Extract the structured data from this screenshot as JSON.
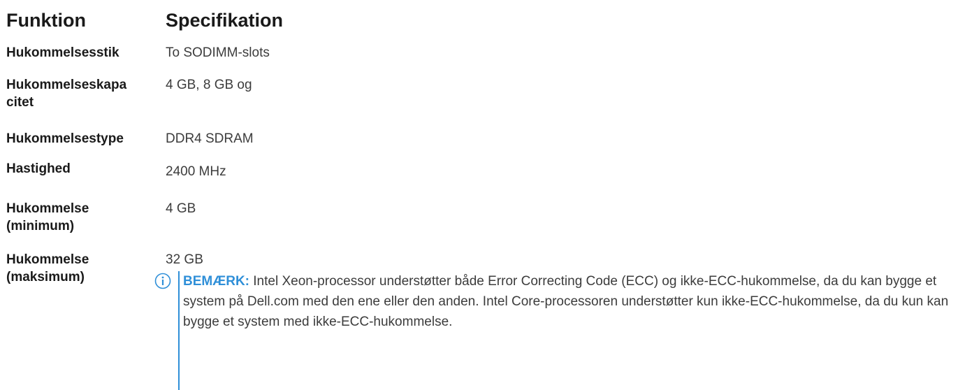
{
  "header": {
    "col1": "Funktion",
    "col2": "Specifikation"
  },
  "rows": [
    {
      "label": "Hukommelsesstik",
      "value": "To SODIMM-slots"
    },
    {
      "label_line1": "Hukommelseskapa",
      "label_line2": "citet",
      "value": "4 GB, 8 GB og"
    },
    {
      "label": "Hukommelsestype",
      "value": "DDR4 SDRAM"
    },
    {
      "label": "Hastighed",
      "value": "2400 MHz"
    },
    {
      "label_line1": "Hukommelse",
      "label_line2": "(minimum)",
      "value": "4 GB"
    },
    {
      "label_line1": "Hukommelse",
      "label_line2": "(maksimum)",
      "value": "32 GB"
    }
  ],
  "note": {
    "icon": "info-icon",
    "label": "BEMÆRK:",
    "text": " Intel Xeon-processor understøtter både Error Correcting Code (ECC) og ikke-ECC-hukommelse, da du kan bygge et system på Dell.com med den ene eller den anden. Intel Core-processoren understøtter kun ikke-ECC-hukommelse, da du kun kan bygge et system med ikke-ECC-hukommelse."
  },
  "colors": {
    "accent": "#2f8fd8",
    "text": "#3c3c3c",
    "heading": "#1a1a1a"
  }
}
